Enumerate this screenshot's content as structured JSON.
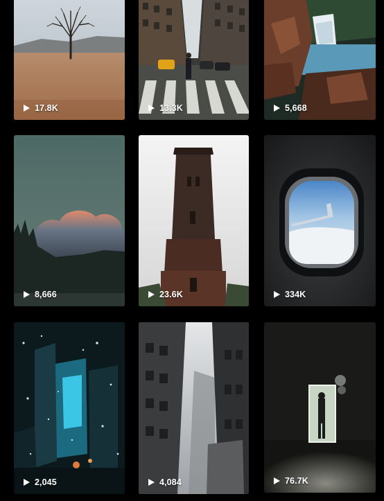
{
  "videos": [
    {
      "views": "17.8K",
      "scene_icon": "bare-tree-field-thumbnail"
    },
    {
      "views": "13.3K",
      "scene_icon": "city-crosswalk-thumbnail"
    },
    {
      "views": "5,668",
      "scene_icon": "waterfall-rocks-thumbnail"
    },
    {
      "views": "8,666",
      "scene_icon": "sunset-cloud-thumbnail"
    },
    {
      "views": "23.6K",
      "scene_icon": "brick-tower-thumbnail"
    },
    {
      "views": "334K",
      "scene_icon": "airplane-window-thumbnail"
    },
    {
      "views": "2,045",
      "scene_icon": "snowy-night-city-thumbnail"
    },
    {
      "views": "4,084",
      "scene_icon": "foggy-skyscrapers-thumbnail"
    },
    {
      "views": "76.7K",
      "scene_icon": "dark-doorway-thumbnail"
    }
  ],
  "icons": {
    "play": "play-icon"
  },
  "colors": {
    "background": "#000000",
    "label": "#ffffff"
  }
}
